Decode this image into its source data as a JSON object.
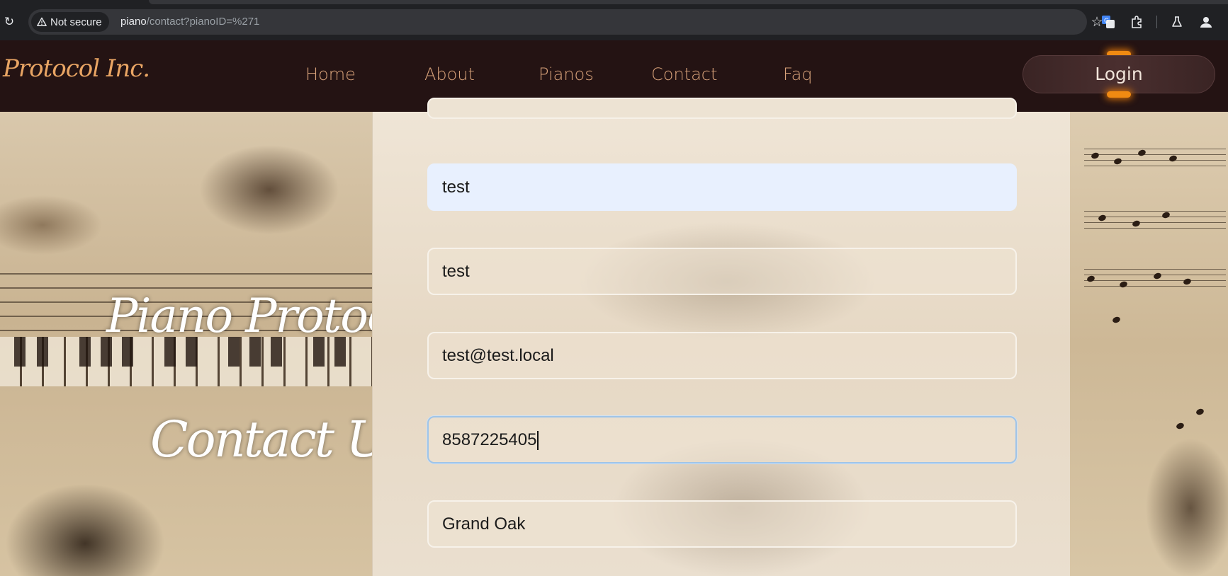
{
  "browser": {
    "security_label": "Not secure",
    "url_host": "piano",
    "url_path": "/contact?pianoID=%271"
  },
  "site": {
    "logo": "Protocol Inc.",
    "nav": {
      "home": "Home",
      "about": "About",
      "pianos": "Pianos",
      "contact": "Contact",
      "faq": "Faq"
    },
    "login_label": "Login"
  },
  "hero": {
    "title": "Piano Protocol Inc",
    "subtitle": "Contact Us"
  },
  "form": {
    "fields": [
      {
        "value": "test",
        "state": "autofilled"
      },
      {
        "value": "test"
      },
      {
        "value": "test@test.local"
      },
      {
        "value": "8587225405",
        "state": "focused"
      },
      {
        "value": "Grand Oak"
      }
    ]
  },
  "colors": {
    "header_bg": "#241313",
    "nav_text": "#d8a27a",
    "logo": "#e9a564",
    "login_glow": "#f08a12"
  }
}
